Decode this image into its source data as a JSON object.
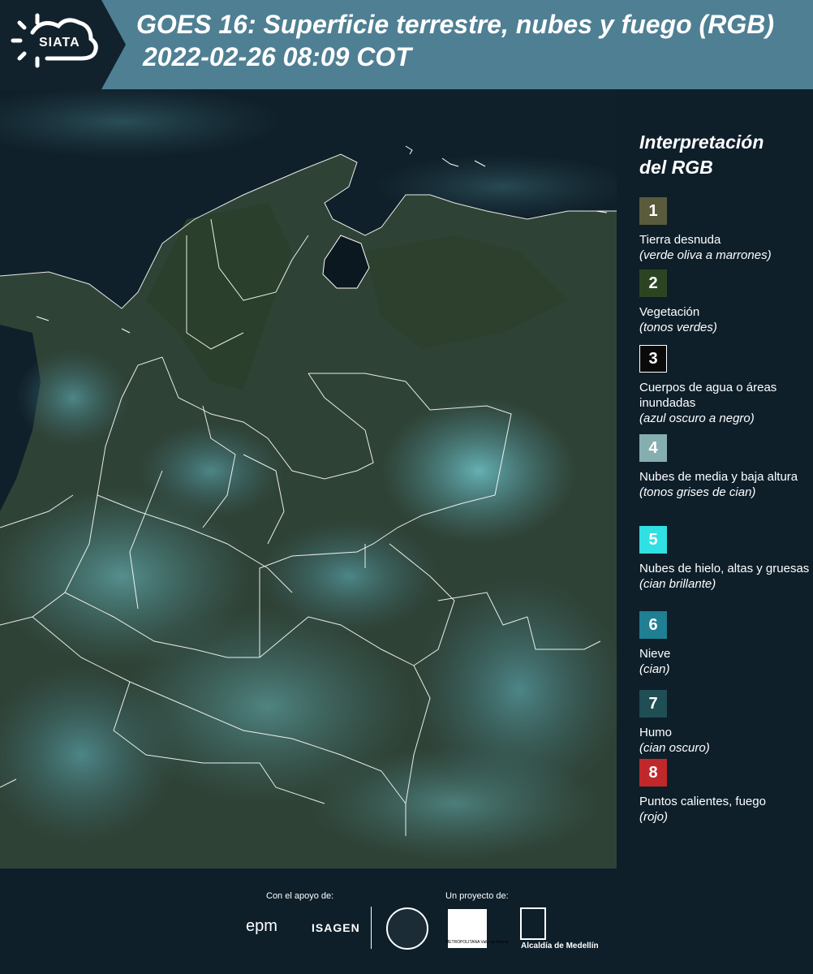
{
  "header": {
    "logo_text": "SIATA",
    "title_line1": "GOES 16: Superficie terrestre, nubes y fuego (RGB)",
    "title_line2": "2022-02-26 08:09 COT",
    "background": "#4f7f93"
  },
  "map": {
    "colors": {
      "ocean": "#10202a",
      "land": "#2f4236",
      "cloud": "#4c8f97",
      "cloud_bright": "#6fc3c9",
      "border": "#ffffff"
    }
  },
  "legend": {
    "title_line1": "Interpretación",
    "title_line2": "del RGB",
    "items": [
      {
        "number": "1",
        "label": "Tierra desnuda",
        "desc": "(verde oliva a marrones)",
        "color": "#5a5a3c"
      },
      {
        "number": "2",
        "label": "Vegetación",
        "desc": "(tonos verdes)",
        "color": "#2d4423"
      },
      {
        "number": "3",
        "label": "Cuerpos de agua o áreas inundadas",
        "desc": "(azul oscuro a negro)",
        "color": "#0a0a0a"
      },
      {
        "number": "4",
        "label": "Nubes de media y baja altura",
        "desc": "(tonos grises de cian)",
        "color": "#86aeb1"
      },
      {
        "number": "5",
        "label": "Nubes de hielo, altas y gruesas",
        "desc": "(cian brillante)",
        "color": "#31e0e2"
      },
      {
        "number": "6",
        "label": "Nieve",
        "desc": "(cian)",
        "color": "#1f7f93"
      },
      {
        "number": "7",
        "label": "Humo",
        "desc": "(cian oscuro)",
        "color": "#1f4e54"
      },
      {
        "number": "8",
        "label": "Puntos calientes, fuego",
        "desc": "(rojo)",
        "color": "#c1282a"
      }
    ]
  },
  "footer": {
    "support_label": "Con el apoyo de:",
    "project_label": "Un proyecto de:",
    "epm": "epm",
    "isagen": "ISAGEN",
    "area_name": "METROPOLITANA Valle de Aburrá",
    "alcaldia": "Alcaldía de Medellín"
  }
}
